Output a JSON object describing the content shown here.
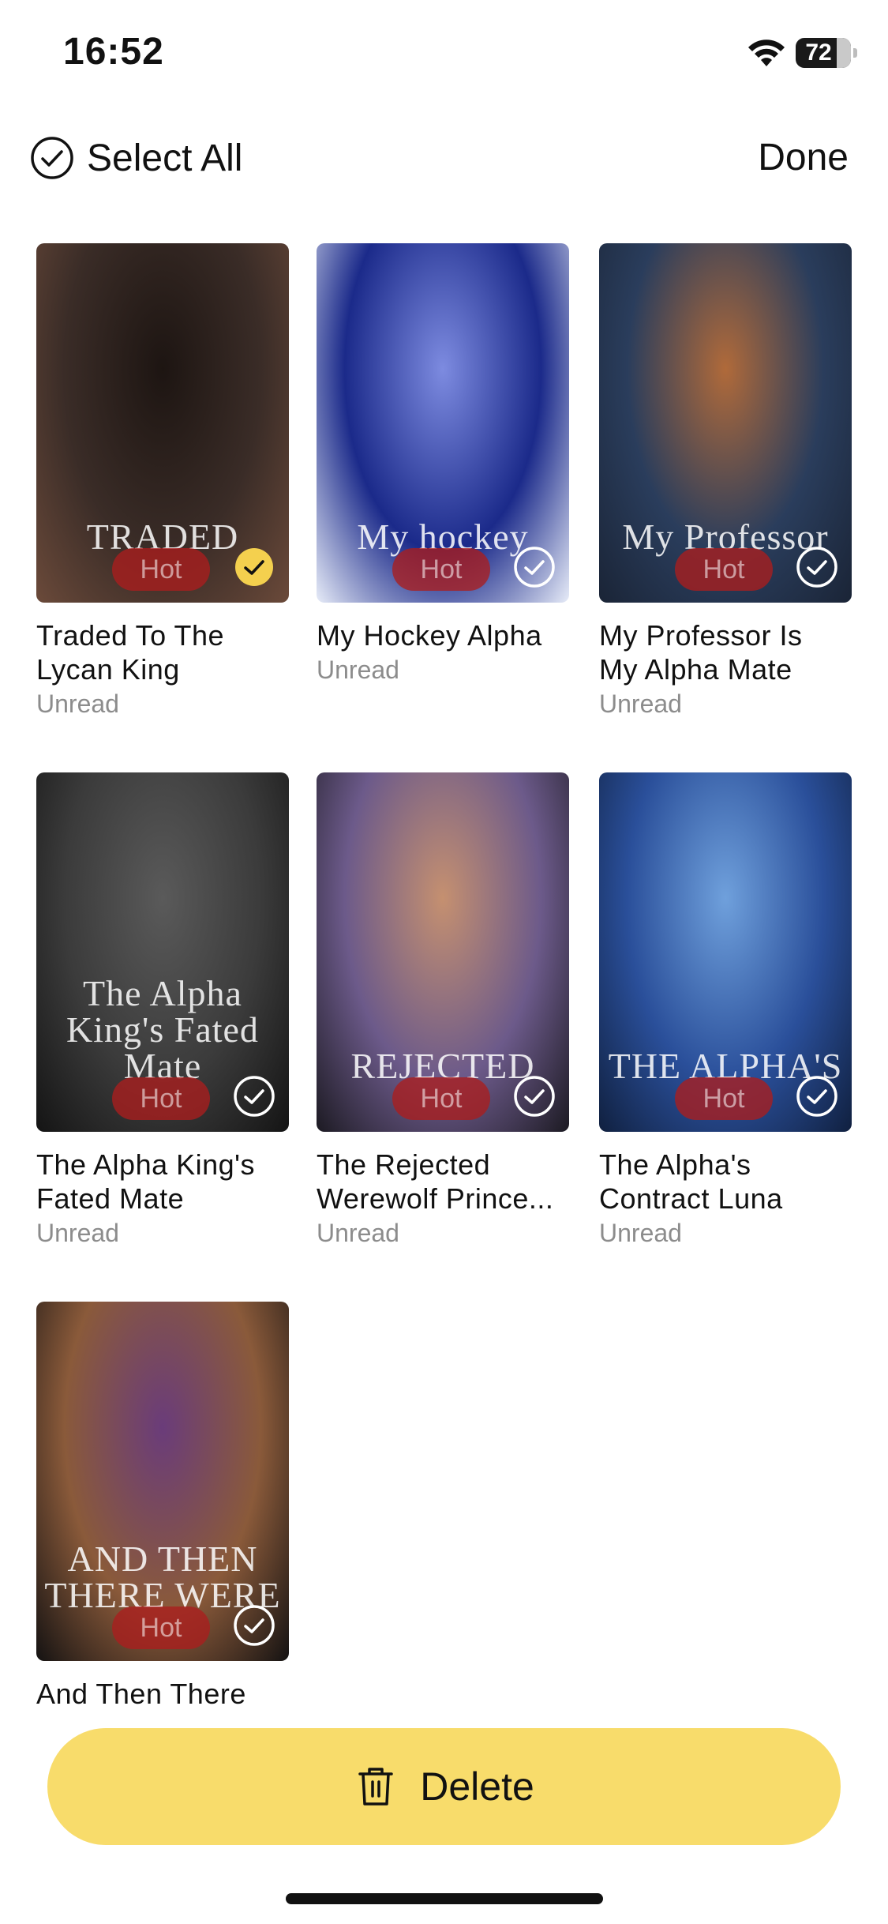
{
  "status_bar": {
    "time": "16:52",
    "battery": "72",
    "icons": [
      "wifi-icon",
      "battery-icon"
    ]
  },
  "header": {
    "select_all_label": "Select All",
    "done_label": "Done"
  },
  "books": [
    {
      "title": "Traded To The Lycan King",
      "title_lines": [
        "Traded To The",
        "Lycan King"
      ],
      "status": "Unread",
      "badge": "Hot",
      "selected": true,
      "cover_text": "TRADED",
      "cover_colors": [
        "#3a2c27",
        "#1d1512",
        "#6b4a3a"
      ]
    },
    {
      "title": "My Hockey Alpha",
      "title_lines": [
        "My Hockey Alpha"
      ],
      "status": "Unread",
      "badge": "Hot",
      "selected": false,
      "cover_text": "My hockey",
      "cover_colors": [
        "#1b2a8a",
        "#7d8be0",
        "#e7ecf8"
      ]
    },
    {
      "title": "My Professor Is My Alpha Mate",
      "title_lines": [
        "My Professor Is",
        "My Alpha Mate"
      ],
      "status": "Unread",
      "badge": "Hot",
      "selected": false,
      "cover_text": "My Professor",
      "cover_colors": [
        "#2a3d5c",
        "#b06a3a",
        "#1a2436"
      ]
    },
    {
      "title": "The Alpha King's Fated Mate",
      "title_lines": [
        "The Alpha King's",
        "Fated Mate"
      ],
      "status": "Unread",
      "badge": "Hot",
      "selected": false,
      "cover_text": "The Alpha King's Fated Mate",
      "cover_colors": [
        "#3b3b3b",
        "#5a5a5a",
        "#141414"
      ]
    },
    {
      "title": "The Rejected Werewolf Prince...",
      "title_lines": [
        "The Rejected",
        "Werewolf Prince..."
      ],
      "status": "Unread",
      "badge": "Hot",
      "selected": false,
      "cover_text": "REJECTED",
      "cover_colors": [
        "#6c5a8a",
        "#c59070",
        "#1c1a22"
      ]
    },
    {
      "title": "The Alpha's Contract Luna",
      "title_lines": [
        "The Alpha's",
        "Contract Luna"
      ],
      "status": "Unread",
      "badge": "Hot",
      "selected": false,
      "cover_text": "THE ALPHA'S",
      "cover_colors": [
        "#2a4f9a",
        "#6fa0dc",
        "#10203f"
      ]
    },
    {
      "title": "And Then There",
      "title_lines": [
        "And Then There"
      ],
      "status": "",
      "badge": "Hot",
      "selected": false,
      "cover_text": "AND THEN THERE WERE",
      "cover_colors": [
        "#8a5a3a",
        "#6a3c7a",
        "#141212"
      ]
    }
  ],
  "delete_label": "Delete",
  "colors": {
    "accent": "#f8dc6b",
    "selected_check": "#f4d04e",
    "hot_badge": "#aa1e1e",
    "muted_text": "#8c8c8c"
  }
}
